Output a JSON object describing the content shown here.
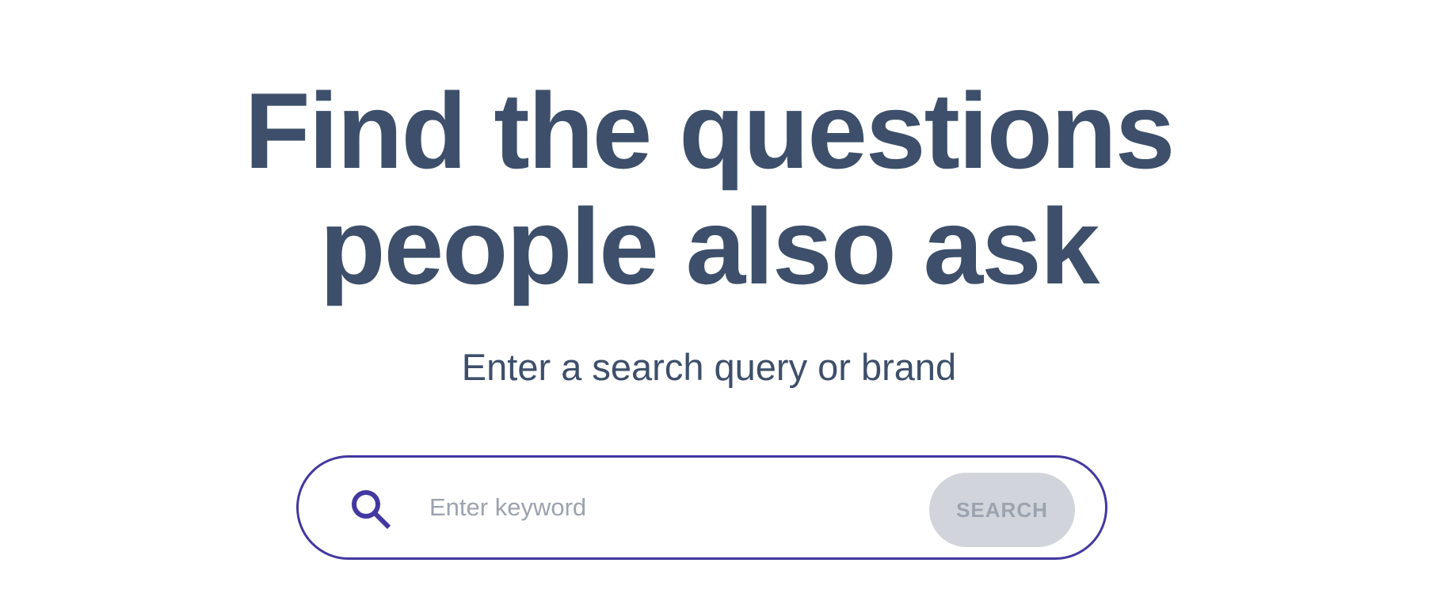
{
  "hero": {
    "headline_line1": "Find the questions",
    "headline_line2": "people also ask",
    "subtitle": "Enter a search query or brand"
  },
  "search": {
    "icon": "search-icon",
    "placeholder": "Enter keyword",
    "value": "",
    "button_label": "SEARCH"
  },
  "colors": {
    "text": "#3d4f6a",
    "accent": "#4338a0",
    "button_bg": "#d1d5db",
    "button_text": "#9ca3af",
    "placeholder": "#9ca3af"
  }
}
